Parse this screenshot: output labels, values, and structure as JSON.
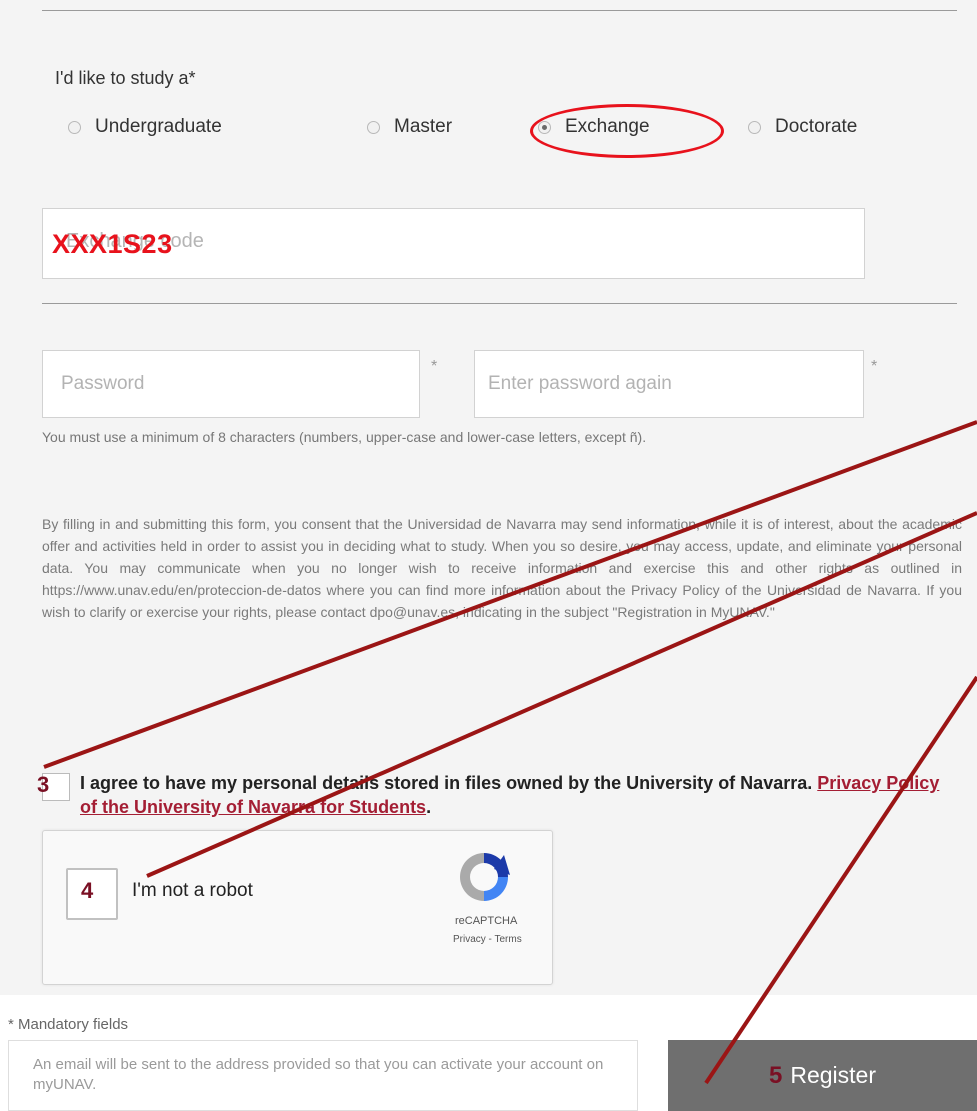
{
  "form": {
    "study_label": "I'd like to study a*",
    "study_options": [
      {
        "label": "Undergraduate",
        "checked": false
      },
      {
        "label": "Master",
        "checked": false
      },
      {
        "label": "Exchange",
        "checked": true
      },
      {
        "label": "Doctorate",
        "checked": false
      }
    ],
    "id_field_placeholder": "Exchange code",
    "id_field_overlay": "XXX1S23",
    "password_placeholder": "Password",
    "password_again_placeholder": "Enter password again",
    "required_mark": "*",
    "password_hint": "You must use a minimum of 8 characters (numbers, upper-case and lower-case letters, except ñ).",
    "legal_text": "By filling in and submitting this form, you consent that the Universidad de Navarra may send information, while it is of interest, about the academic offer and activities held in order to assist you in deciding what to study. When you so desire, you may access, update, and eliminate your personal data. You may communicate when you no longer wish to receive information and exercise this and other rights as outlined in https://www.unav.edu/en/proteccion-de-datos where you can find more information about the Privacy Policy of the Universidad de Navarra. If you wish to clarify or exercise your rights, please contact dpo@unav.es, indicating in the subject \"Registration in MyUNAV.\"",
    "agree_text": "I agree to have my personal details stored in files owned by the University of Navarra.",
    "agree_link": "Privacy Policy of the University of Navarra for Students",
    "agree_period": ".",
    "captcha": {
      "label": "I'm not a robot",
      "brand": "reCAPTCHA",
      "links": "Privacy - Terms"
    },
    "mandatory_note": "* Mandatory fields",
    "email_note": "An email will be sent to the address provided so that you can activate your account on myUNAV.",
    "register_label": "Register"
  },
  "annotations": {
    "step3": "3",
    "step4": "4",
    "step5": "5",
    "circle_color": "#e8121c",
    "arrow_color": "#9b1515"
  }
}
